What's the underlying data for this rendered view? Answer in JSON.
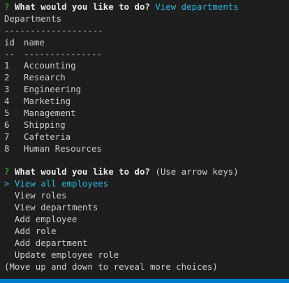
{
  "prompt1": {
    "marker": "?",
    "question": "What would you like to do?",
    "answer": "View departments"
  },
  "table": {
    "title": "Departments",
    "title_underline": "-------------------",
    "headers": [
      "id",
      "name"
    ],
    "header_underline": [
      "--",
      "---------------"
    ],
    "rows": [
      [
        "1",
        "Accounting"
      ],
      [
        "2",
        "Research"
      ],
      [
        "3",
        "Engineering"
      ],
      [
        "4",
        "Marketing"
      ],
      [
        "5",
        "Management"
      ],
      [
        "6",
        "Shipping"
      ],
      [
        "7",
        "Cafeteria"
      ],
      [
        "8",
        "Human Resources"
      ]
    ]
  },
  "prompt2": {
    "marker": "?",
    "question": "What would you like to do?",
    "hint": "(Use arrow keys)",
    "pointer": ">",
    "choices": [
      "View all employees",
      "View roles",
      "View departments",
      "Add employee",
      "Add role",
      "Add department",
      "Update employee role"
    ],
    "footer": "(Move up and down to reveal more choices)"
  },
  "colors": {
    "background": "#1e1e1e",
    "text": "#cccccc",
    "prompt_marker": "#3fbf3f",
    "accent": "#29b8db",
    "statusbar": "#007acc"
  }
}
